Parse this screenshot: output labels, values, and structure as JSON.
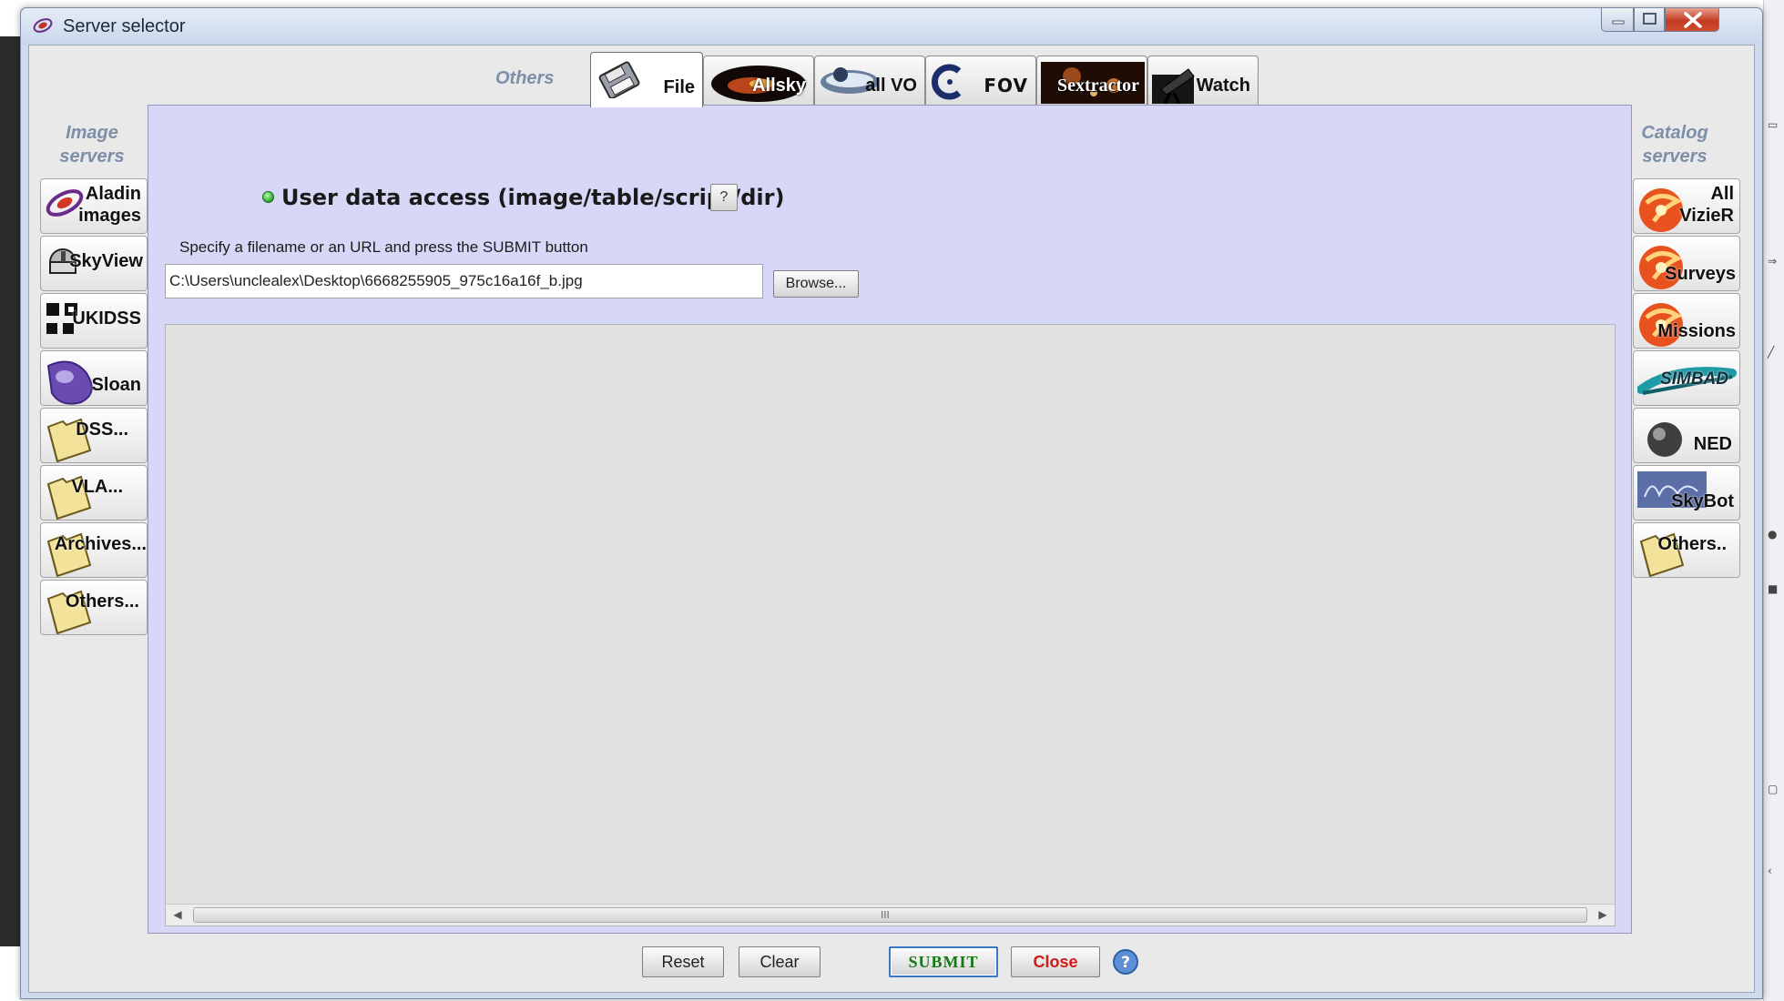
{
  "window": {
    "title": "Server selector"
  },
  "tabs": {
    "others_label": "Others",
    "items": [
      {
        "label": "File",
        "icon": "floppy-disk-icon",
        "active": true
      },
      {
        "label": "Allsky",
        "icon": "allsky-icon",
        "active": false
      },
      {
        "label": "all VO",
        "icon": "vo-icon",
        "active": false
      },
      {
        "label": "FOV",
        "icon": "fov-icon",
        "active": false
      },
      {
        "label": "Sextractor",
        "icon": "sextractor-icon",
        "active": false
      },
      {
        "label": "Watch",
        "icon": "telescope-icon",
        "active": false
      }
    ]
  },
  "left_sidebar": {
    "label_line1": "Image",
    "label_line2": "servers",
    "items": [
      {
        "label_line1": "Aladin",
        "label_line2": "images",
        "icon": "aladin-icon"
      },
      {
        "label": "SkyView",
        "icon": "telescope-dome-icon"
      },
      {
        "label": "UKIDSS",
        "icon": "ukidss-icon"
      },
      {
        "label": "Sloan",
        "icon": "sloan-icon"
      },
      {
        "label": "DSS...",
        "icon": "folder-icon"
      },
      {
        "label": "VLA...",
        "icon": "folder-icon"
      },
      {
        "label": "Archives...",
        "icon": "folder-icon"
      },
      {
        "label": "Others...",
        "icon": "folder-icon"
      }
    ]
  },
  "right_sidebar": {
    "label_line1": "Catalog",
    "label_line2": "servers",
    "items": [
      {
        "label_line1": "All",
        "label_line2": "VizieR",
        "icon": "vizier-icon"
      },
      {
        "label": "Surveys",
        "icon": "vizier-icon"
      },
      {
        "label": "Missions",
        "icon": "vizier-icon"
      },
      {
        "label": "SIMBAD",
        "icon": "simbad-icon"
      },
      {
        "label": "NED",
        "icon": "ned-icon"
      },
      {
        "label": "SkyBot",
        "icon": "skybot-icon"
      },
      {
        "label": "Others..",
        "icon": "folder-icon"
      }
    ]
  },
  "panel": {
    "title": "User data access (image/table/script/dir)",
    "help_label": "?",
    "instruction": "Specify a filename or an URL and press the SUBMIT button",
    "path_value": "C:\\Users\\unclealex\\Desktop\\6668255905_975c16a16f_b.jpg",
    "browse_label": "Browse...",
    "scroll_grip": "III"
  },
  "footer": {
    "reset_label": "Reset",
    "clear_label": "Clear",
    "submit_label": "SUBMIT",
    "close_label": "Close"
  },
  "colors": {
    "panel_bg": "#d7d7f7",
    "submit_text": "#137a13",
    "close_text": "#d11b1b",
    "status_dot": "#2aa12a",
    "side_label": "#7d8fa8"
  }
}
